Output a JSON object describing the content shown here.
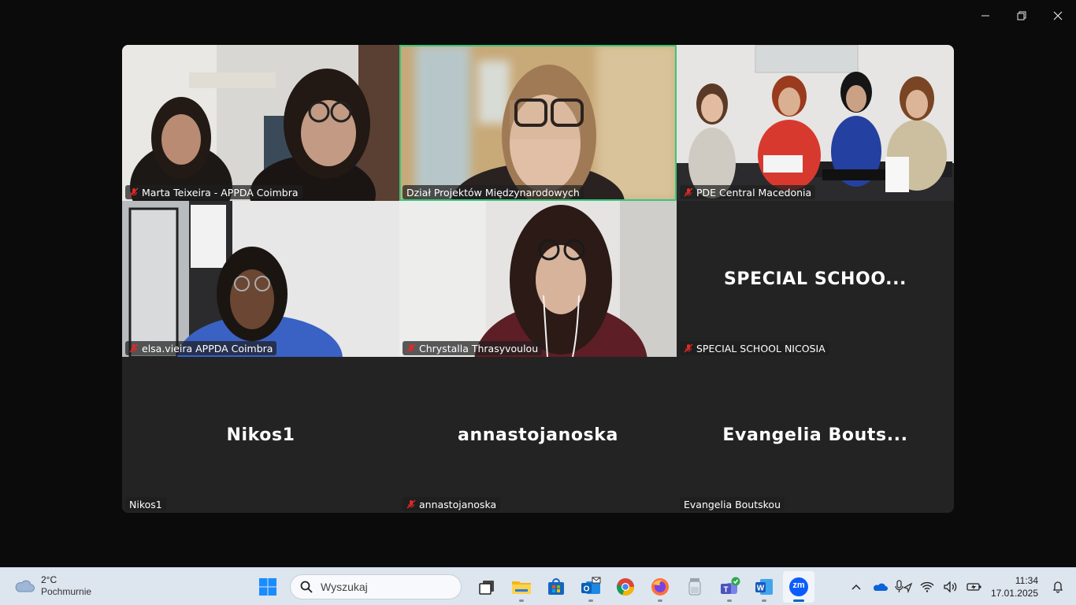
{
  "window": {
    "controls": {
      "minimize_icon": "minimize-icon",
      "restore_icon": "restore-icon",
      "close_icon": "close-icon"
    }
  },
  "gallery": {
    "active_speaker_color": "#34c77b",
    "tiles": [
      {
        "name": "Marta Teixeira - APPDA Coimbra",
        "muted": true,
        "video": true
      },
      {
        "name": "Dział Projektów Międzynarodowych",
        "muted": false,
        "video": true,
        "active_speaker": true
      },
      {
        "name": "PDE Central Macedonia",
        "muted": true,
        "video": true
      },
      {
        "name": "elsa.vieira APPDA Coimbra",
        "muted": true,
        "video": true
      },
      {
        "name": "Chrystalla Thrasyvoulou",
        "muted": true,
        "video": true
      },
      {
        "name": "SPECIAL SCHOOL NICOSIA",
        "placeholder": "SPECIAL  SCHOO...",
        "muted": true,
        "video": false
      },
      {
        "name": "Nikos1",
        "placeholder": "Nikos1",
        "muted": false,
        "video": false
      },
      {
        "name": "annastojanoska",
        "placeholder": "annastojanoska",
        "muted": true,
        "video": false
      },
      {
        "name": "Evangelia Boutskou",
        "placeholder": "Evangelia  Bouts...",
        "muted": false,
        "video": false
      }
    ]
  },
  "taskbar": {
    "weather": {
      "temp": "2°C",
      "condition": "Pochmurnie",
      "icon": "cloud-icon"
    },
    "search": {
      "placeholder": "Wyszukaj"
    },
    "apps": [
      {
        "name": "start",
        "icon": "windows-icon"
      },
      {
        "name": "task-view",
        "icon": "task-view-icon"
      },
      {
        "name": "file-explorer",
        "icon": "folder-icon"
      },
      {
        "name": "microsoft-store",
        "icon": "store-icon"
      },
      {
        "name": "outlook",
        "icon": "outlook-icon"
      },
      {
        "name": "chrome",
        "icon": "chrome-icon"
      },
      {
        "name": "firefox",
        "icon": "firefox-icon"
      },
      {
        "name": "recycle",
        "icon": "jar-icon"
      },
      {
        "name": "teams",
        "icon": "teams-icon"
      },
      {
        "name": "word",
        "icon": "word-icon"
      },
      {
        "name": "zoom",
        "icon": "zoom-icon",
        "label": "zm",
        "active": true
      }
    ],
    "tray": {
      "icons": [
        "chevron-up-icon",
        "onedrive-icon",
        "mic-location-icon",
        "wifi-icon",
        "volume-icon",
        "battery-icon"
      ],
      "time": "11:34",
      "date": "17.01.2025",
      "notification_icon": "bell-icon"
    }
  }
}
